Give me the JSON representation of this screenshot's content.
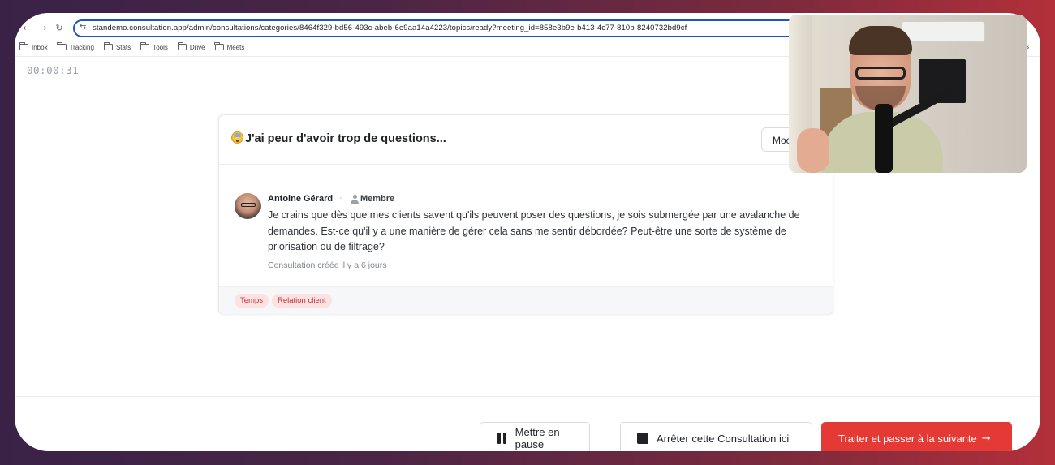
{
  "browser": {
    "url": "standemo.consultation.app/admin/consultations/categories/8464f329-bd56-493c-abeb-6e9aa14a4223/topics/ready?meeting_id=858e3b9e-b413-4c77-810b-8240732bd9cf",
    "bookmarks": [
      "Inbox",
      "Tracking",
      "Stats",
      "Tools",
      "Drive",
      "Meets"
    ],
    "bookmarks_right": "arks"
  },
  "timer": "00:00:31",
  "card": {
    "title": "J'ai peur d'avoir trop de questions...",
    "modify_label": "Moc",
    "author": "Antoine Gérard",
    "separator": "·",
    "role": "Membre",
    "message": "Je crains que dès que mes clients savent qu'ils peuvent poser des questions, je sois submergée par une avalanche de demandes. Est-ce qu'il y a une manière de gérer cela sans me sentir débordée? Peut-être une sorte de système de priorisation ou de filtrage?",
    "created": "Consultation créée il y a 6 jours",
    "tags": [
      "Temps",
      "Relation client"
    ]
  },
  "actions": {
    "pause": "Mettre en pause",
    "stop": "Arrêter cette Consultation ici",
    "next": "Traiter et passer à la suivante",
    "next_icon": "→"
  },
  "icons": {
    "back": "←",
    "forward": "→",
    "reload": "↻",
    "tune": "⇆"
  },
  "colors": {
    "primary": "#e53935",
    "tag_bg": "#fde2e2",
    "tag_text": "#c5303a",
    "url_border": "#1a56c4"
  }
}
